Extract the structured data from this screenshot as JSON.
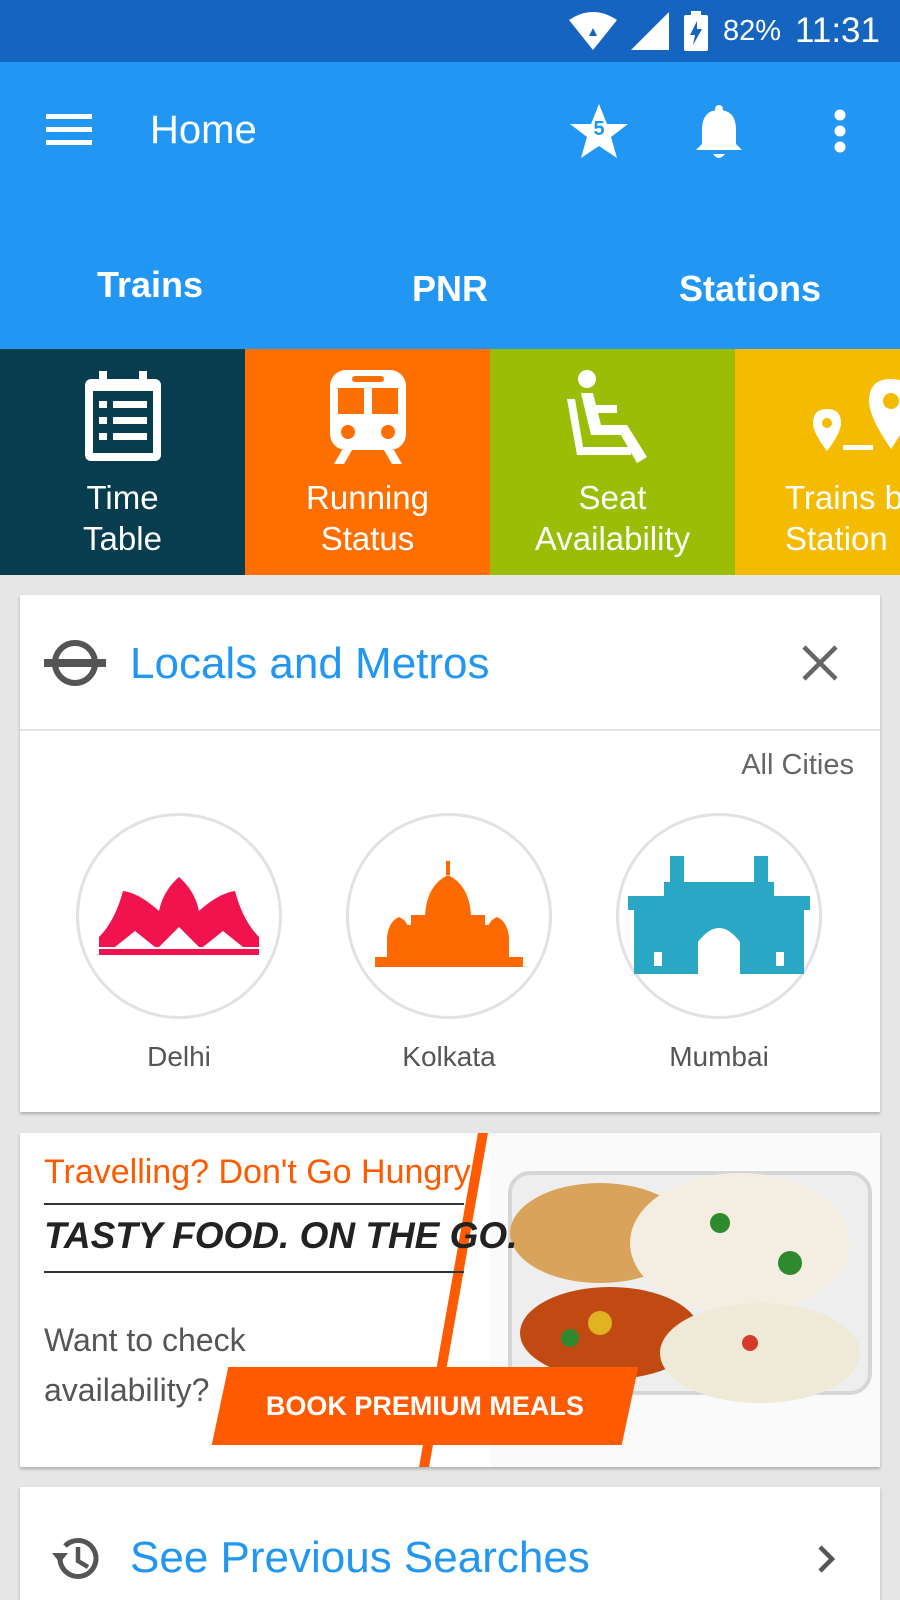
{
  "status_bar": {
    "battery_percent": "82%",
    "time": "11:31",
    "icons": [
      "wifi-icon",
      "cell-signal-icon",
      "battery-charging-icon"
    ]
  },
  "app_bar": {
    "title": "Home",
    "favorites_count": "5",
    "icons": [
      "menu-icon",
      "star-icon",
      "bell-icon",
      "more-vert-icon"
    ]
  },
  "tabs": [
    {
      "label": "Trains",
      "active": true
    },
    {
      "label": "PNR",
      "active": false
    },
    {
      "label": "Stations",
      "active": false
    }
  ],
  "tiles": [
    {
      "label": "Time\nTable",
      "icon": "calendar-list-icon",
      "color": "#073d4e"
    },
    {
      "label": "Running\nStatus",
      "icon": "train-icon",
      "color": "#ff6f00"
    },
    {
      "label": "Seat\nAvailability",
      "icon": "seat-icon",
      "color": "#9cbd05"
    },
    {
      "label": "Trains b\nStation",
      "icon": "route-pins-icon",
      "color": "#f4bb00"
    }
  ],
  "locals_card": {
    "title": "Locals and Metros",
    "all_cities": "All Cities",
    "cities": [
      {
        "name": "Delhi",
        "icon": "lotus-temple-icon",
        "color": "#f0134d"
      },
      {
        "name": "Kolkata",
        "icon": "victoria-memorial-icon",
        "color": "#ff6a00"
      },
      {
        "name": "Mumbai",
        "icon": "gateway-of-india-icon",
        "color": "#2aa7c4"
      }
    ]
  },
  "ad": {
    "line1": "Travelling? Don't Go Hungry!",
    "line2": "TASTY FOOD. ON THE GO.",
    "line3": "Want to check\navailability?",
    "cta": "BOOK PREMIUM MEALS",
    "accent": "#ff5a00"
  },
  "previous_searches": {
    "label": "See Previous Searches"
  },
  "colors": {
    "primary": "#2196f3",
    "primary_dark": "#1565c0"
  }
}
